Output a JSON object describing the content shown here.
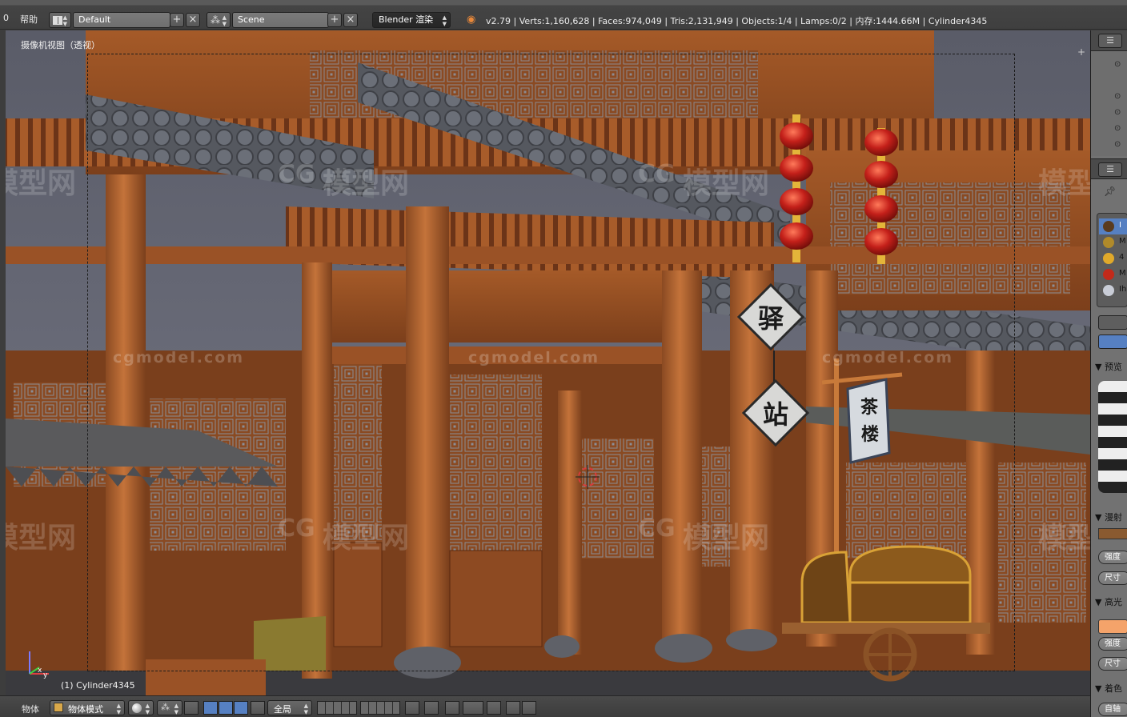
{
  "top_header": {
    "menu_fragment": "0",
    "help_menu": "帮助",
    "screen_layout": "Default",
    "scene": "Scene",
    "render_engine": "Blender 渲染",
    "stats": "v2.79 | Verts:1,160,628 | Faces:974,049 | Tris:2,131,949 | Objects:1/4 | Lamps:0/2 | 内存:1444.66M | Cylinder4345",
    "add_symbol": "+",
    "close_symbol": "×"
  },
  "viewport": {
    "view_label": "摄像机视图（透视）",
    "active_object_label": "(1) Cylinder4345",
    "sign_top": "驿",
    "sign_bottom": "站",
    "banner_line1": "茶",
    "banner_line2": "楼",
    "axis_x": "x",
    "axis_y": "y",
    "watermark_url": "cgmodel.com",
    "watermark_cn": "模型网",
    "watermark_logo": "CG"
  },
  "right_panel": {
    "materials": [
      {
        "label": "I",
        "color": "#5a3b1f"
      },
      {
        "label": "M",
        "color": "#b08a2a"
      },
      {
        "label": "4",
        "color": "#e0a92a"
      },
      {
        "label": "M",
        "color": "#c22a1a"
      },
      {
        "label": "Ih",
        "color": "#c8ccd6"
      }
    ],
    "section_preview": "▼ 预览",
    "section_diffuse": "▼ 漫射",
    "section_specular": "▼ 高光",
    "section_shading": "▼ 着色",
    "intensity_label": "强度",
    "size_label": "尺寸",
    "auto_label": "自轴"
  },
  "bottom_header": {
    "menu_object": "物体",
    "mode": "物体模式",
    "pivot_scope": "全局"
  }
}
